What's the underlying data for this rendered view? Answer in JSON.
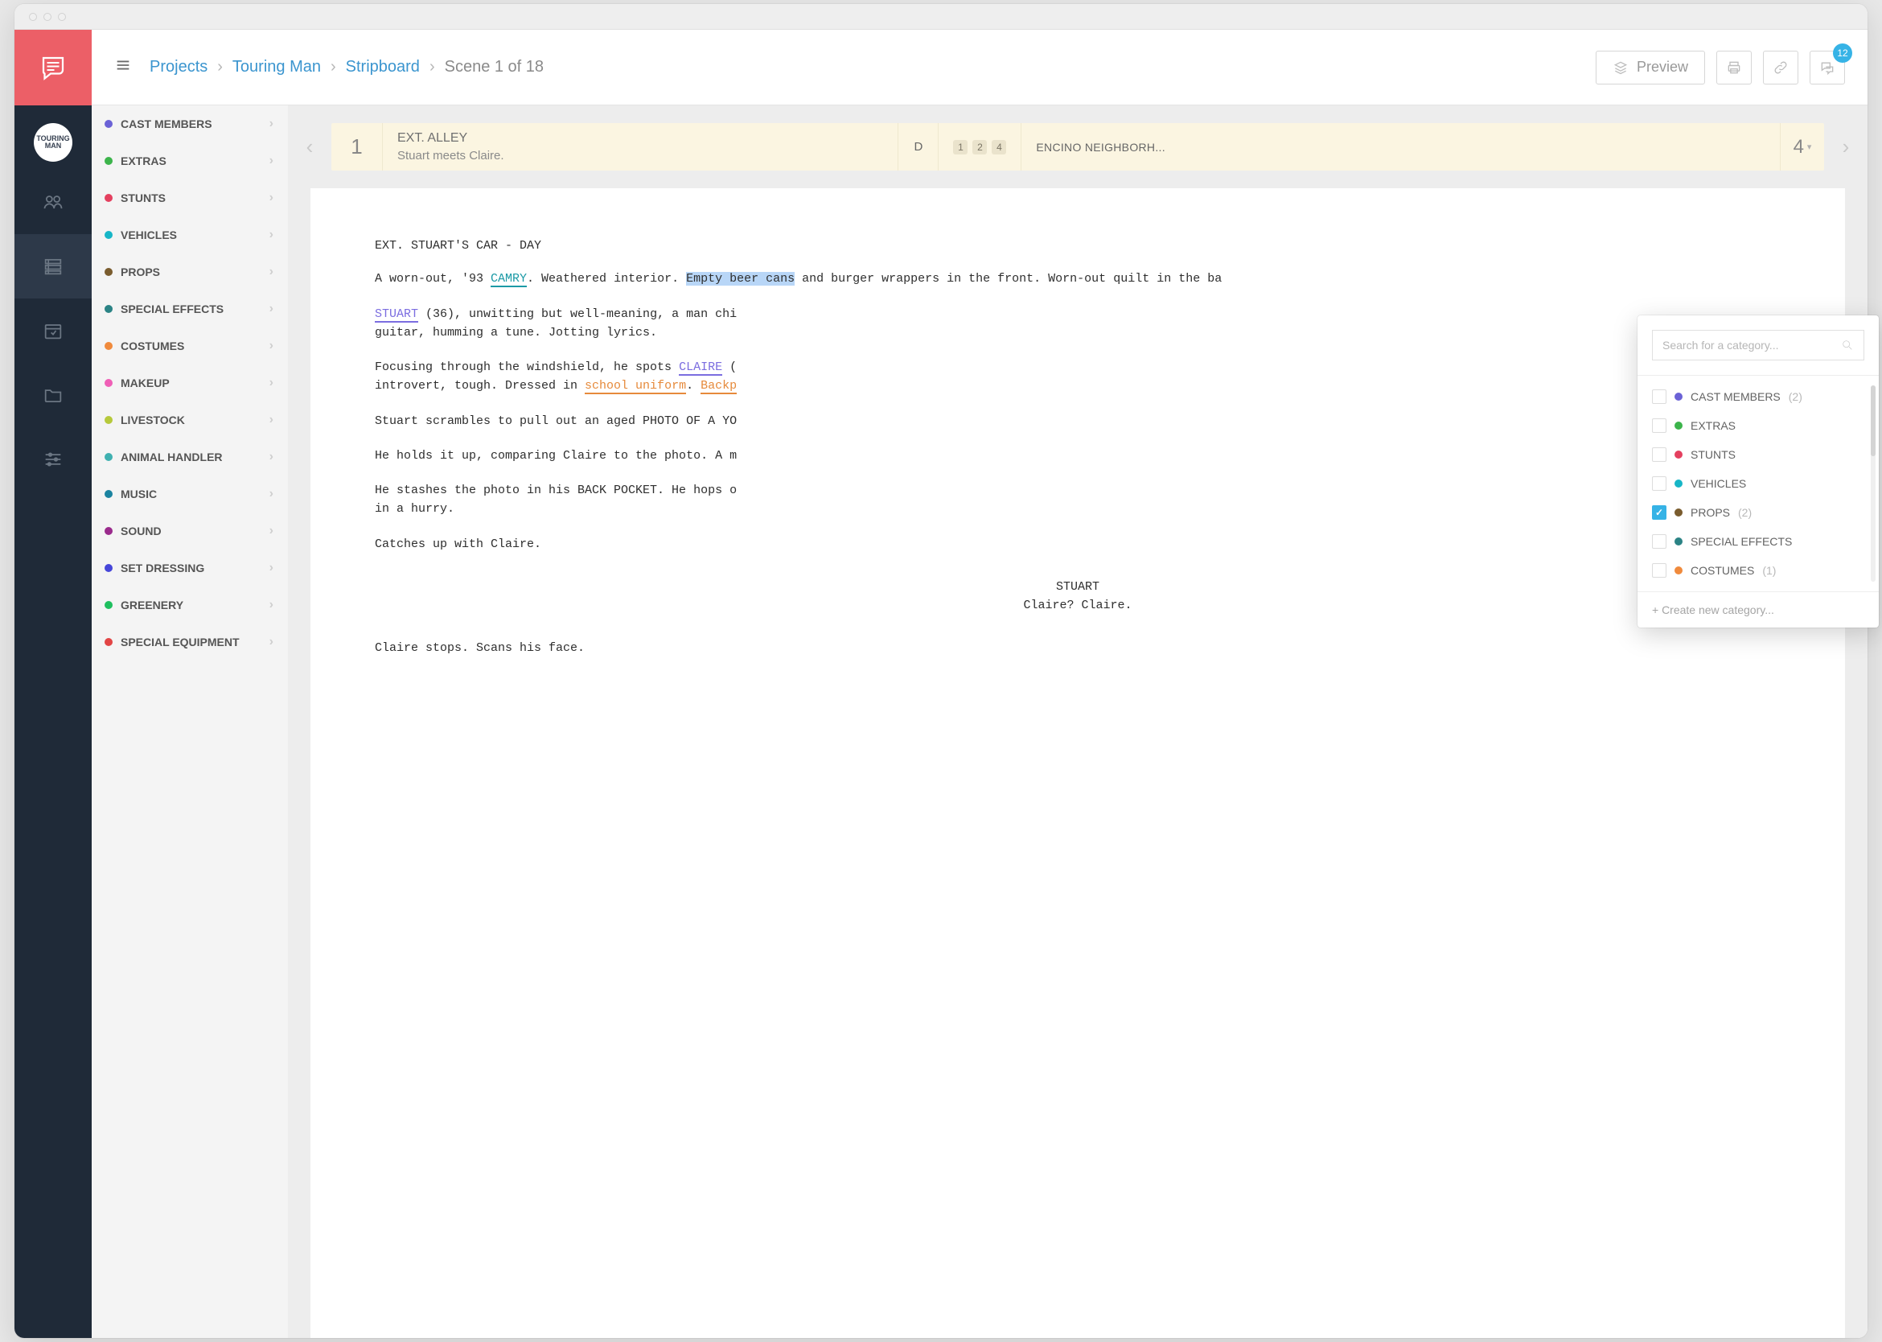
{
  "breadcrumbs": {
    "a": "Projects",
    "b": "Touring Man",
    "c": "Stripboard",
    "d": "Scene 1 of 18"
  },
  "topbar": {
    "preview": "Preview",
    "comment_badge": "12"
  },
  "project_badge": "TOURING MAN",
  "categories": [
    {
      "label": "CAST MEMBERS",
      "color": "#6b62d6"
    },
    {
      "label": "EXTRAS",
      "color": "#3cb44b"
    },
    {
      "label": "STUNTS",
      "color": "#e4405f"
    },
    {
      "label": "VEHICLES",
      "color": "#17b6c7"
    },
    {
      "label": "PROPS",
      "color": "#7a5c2e"
    },
    {
      "label": "SPECIAL EFFECTS",
      "color": "#2b8385"
    },
    {
      "label": "COSTUMES",
      "color": "#f08a3c"
    },
    {
      "label": "MAKEUP",
      "color": "#ef5fb6"
    },
    {
      "label": "LIVESTOCK",
      "color": "#b6c93b"
    },
    {
      "label": "ANIMAL HANDLER",
      "color": "#3fb0b0"
    },
    {
      "label": "MUSIC",
      "color": "#1a83a0"
    },
    {
      "label": "SOUND",
      "color": "#9a2a8c"
    },
    {
      "label": "SET DRESSING",
      "color": "#4646d9"
    },
    {
      "label": "GREENERY",
      "color": "#1fbf5f"
    },
    {
      "label": "SPECIAL EQUIPMENT",
      "color": "#e24444"
    }
  ],
  "scene_strip": {
    "num": "1",
    "title": "EXT. ALLEY",
    "summary": "Stuart meets Claire.",
    "daynight": "D",
    "tags": [
      "1",
      "2",
      "4"
    ],
    "location": "ENCINO NEIGHBORH...",
    "count": "4"
  },
  "script": {
    "slugline": "EXT. STUART'S CAR - DAY",
    "line_pre_camry": "A worn-out, '93 ",
    "camry": "CAMRY",
    "line_post_camry": ". Weathered interior. ",
    "beercans": "Empty beer cans",
    "line_after_cans": " and burger wrappers in the front. Worn-out quilt in the ba",
    "stuart": "STUART",
    "stuart_desc": " (36), unwitting but well-meaning, a man chi",
    "stuart_desc2": "guitar, humming a tune. Jotting lyrics.",
    "claire_pre": "Focusing through the windshield, he spots ",
    "claire": "CLAIRE",
    "claire_post": " (",
    "claire_line2_pre": "introvert, tough. Dressed in ",
    "uniform": "school uniform",
    "claire_line2_mid": ". ",
    "backpack": "Backp",
    "p4": "Stuart scrambles to pull out an aged PHOTO OF A YO",
    "p5": "He holds it up, comparing Claire to the photo. A m",
    "p6": "He stashes the photo in his BACK POCKET. He hops o",
    "p6b": "in a hurry.",
    "p7": "Catches up with Claire.",
    "cue_char": "STUART",
    "cue_line": "Claire? Claire.",
    "p8": "Claire stops. Scans his face."
  },
  "popover": {
    "placeholder": "Search for a category...",
    "items": [
      {
        "label": "CAST MEMBERS",
        "color": "#6b62d6",
        "count": "(2)",
        "checked": false
      },
      {
        "label": "EXTRAS",
        "color": "#3cb44b",
        "count": "",
        "checked": false
      },
      {
        "label": "STUNTS",
        "color": "#e4405f",
        "count": "",
        "checked": false
      },
      {
        "label": "VEHICLES",
        "color": "#17b6c7",
        "count": "",
        "checked": false
      },
      {
        "label": "PROPS",
        "color": "#7a5c2e",
        "count": "(2)",
        "checked": true
      },
      {
        "label": "SPECIAL EFFECTS",
        "color": "#2b8385",
        "count": "",
        "checked": false
      },
      {
        "label": "COSTUMES",
        "color": "#f08a3c",
        "count": "(1)",
        "checked": false
      }
    ],
    "footer": "+ Create new category..."
  }
}
